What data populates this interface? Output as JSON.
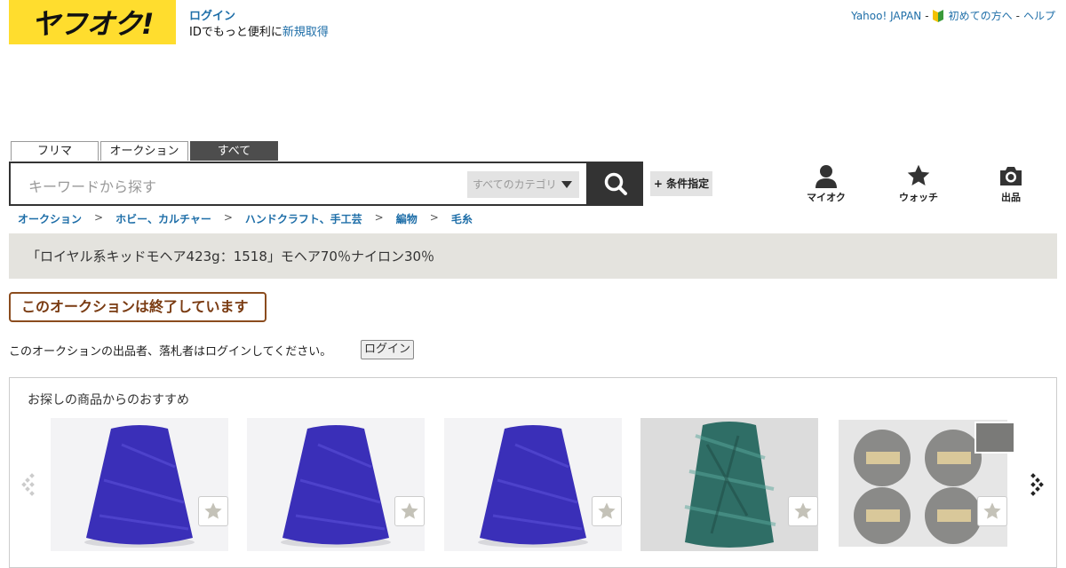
{
  "header": {
    "logo_text": "ヤフオク!",
    "login_link": "ログイン",
    "login_prompt": "IDでもっと便利に",
    "register_link": "新規取得",
    "nav": {
      "yahoo": "Yahoo! JAPAN",
      "sep": "-",
      "first_time": "初めての方へ",
      "help": "ヘルプ"
    }
  },
  "search": {
    "tabs": [
      {
        "label": "フリマ"
      },
      {
        "label": "オークション"
      },
      {
        "label": "すべて"
      }
    ],
    "active_tab": "すべて",
    "placeholder": "キーワードから探す",
    "category": "すべてのカテゴリ",
    "conditions_label": "+ 条件指定"
  },
  "icon_nav": [
    {
      "label": "マイオク",
      "icon": "person-icon"
    },
    {
      "label": "ウォッチ",
      "icon": "star-icon"
    },
    {
      "label": "出品",
      "icon": "camera-icon"
    }
  ],
  "breadcrumb": [
    "オークション",
    "ホビー、カルチャー",
    "ハンドクラフト、手工芸",
    "編物",
    "毛糸"
  ],
  "breadcrumb_sep": ">",
  "item_title": "「ロイヤル系キッドモヘア423g：1518」モヘア70％ナイロン30％",
  "ended_notice": "このオークションは終了しています",
  "login_notice": "このオークションの出品者、落札者はログインしてください。",
  "login_button": "ログイン",
  "recommendations": {
    "heading": "お探しの商品からのおすすめ",
    "items": [
      {
        "color": "#3a2fb8",
        "kind": "cone"
      },
      {
        "color": "#3a2fb8",
        "kind": "cone"
      },
      {
        "color": "#3a2fb8",
        "kind": "cone"
      },
      {
        "color": "#2f6e66",
        "kind": "cone"
      },
      {
        "color": "#8a8a88",
        "kind": "balls"
      }
    ]
  },
  "colors": {
    "brand_yellow": "#ffdd2e",
    "link": "#1e6ea8",
    "title_bar": "#e4e3de",
    "ended_border": "#8b4c1e"
  }
}
